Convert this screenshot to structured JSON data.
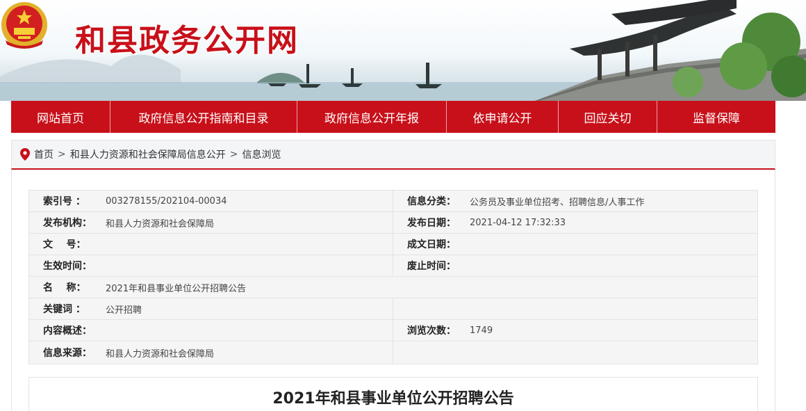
{
  "header": {
    "site_title": "和县政务公开网",
    "emblem_icon": "national-emblem-icon"
  },
  "nav": {
    "items": [
      {
        "label": "网站首页"
      },
      {
        "label": "政府信息公开指南和目录"
      },
      {
        "label": "政府信息公开年报"
      },
      {
        "label": "依申请公开"
      },
      {
        "label": "回应关切"
      },
      {
        "label": "监督保障"
      }
    ]
  },
  "breadcrumb": {
    "icon": "location-pin-icon",
    "items": [
      "首页",
      "和县人力资源和社会保障局信息公开",
      "信息浏览"
    ],
    "separator": ">"
  },
  "meta": {
    "index_label": "索引号 ：",
    "index_value": "003278155/202104-00034",
    "category_label": "信息分类：",
    "category_value": "公务员及事业单位招考、招聘信息/人事工作",
    "publisher_label": "发布机构：",
    "publisher_value": "和县人力资源和社会保障局",
    "pubdate_label": "发布日期：",
    "pubdate_value": "2021-04-12 17:32:33",
    "docno_label": "文    号：",
    "docno_value": "",
    "createdate_label": "成文日期：",
    "createdate_value": "",
    "effective_label": "生效时间：",
    "effective_value": "",
    "expire_label": "废止时间：",
    "expire_value": "",
    "name_label": "名    称：",
    "name_value": "2021年和县事业单位公开招聘公告",
    "keyword_label": "关键词 ：",
    "keyword_value": "公开招聘",
    "summary_label": "内容概述：",
    "summary_value": "",
    "views_label": "浏览次数：",
    "views_value": "1749",
    "source_label": "信息来源：",
    "source_value": "和县人力资源和社会保障局"
  },
  "article": {
    "title": "2021年和县事业单位公开招聘公告"
  },
  "colors": {
    "brand_red": "#c8101a",
    "meta_bg": "#f5f5f5"
  }
}
